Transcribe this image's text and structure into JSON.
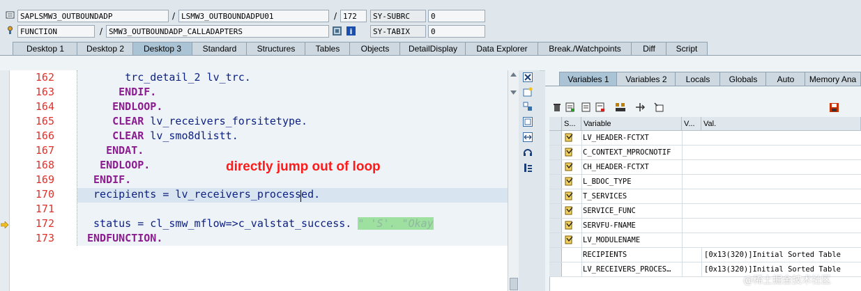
{
  "header": {
    "program": "SAPLSMW3_OUTBOUNDADP",
    "include": "LSMW3_OUTBOUNDADPU01",
    "line": "172",
    "subrc_label": "SY-SUBRC",
    "subrc_value": "0",
    "event_type": "FUNCTION",
    "event_name": "SMW3_OUTBOUNDADP_CALLADAPTERS",
    "tabix_label": "SY-TABIX",
    "tabix_value": "0",
    "slash": "/"
  },
  "tabs": [
    "Desktop 1",
    "Desktop 2",
    "Desktop 3",
    "Standard",
    "Structures",
    "Tables",
    "Objects",
    "DetailDisplay",
    "Data Explorer",
    "Break./Watchpoints",
    "Diff",
    "Script"
  ],
  "code": [
    {
      "num": "162",
      "indent": "      ",
      "kw": "",
      "text": "trc_detail_2 lv_trc."
    },
    {
      "num": "163",
      "indent": "     ",
      "kw": "ENDIF.",
      "text": ""
    },
    {
      "num": "164",
      "indent": "    ",
      "kw": "ENDLOOP.",
      "text": ""
    },
    {
      "num": "165",
      "indent": "    ",
      "kw": "CLEAR",
      "text": " lv_receivers_forsitetype."
    },
    {
      "num": "166",
      "indent": "    ",
      "kw": "CLEAR",
      "text": " lv_smo8dlistt."
    },
    {
      "num": "167",
      "indent": "   ",
      "kw": "ENDAT.",
      "text": ""
    },
    {
      "num": "168",
      "indent": "  ",
      "kw": "ENDLOOP.",
      "text": ""
    },
    {
      "num": "169",
      "indent": " ",
      "kw": "ENDIF.",
      "text": ""
    },
    {
      "num": "170",
      "indent": " ",
      "kw": "",
      "text": "recipients = lv_receivers_processed."
    },
    {
      "num": "171",
      "indent": "",
      "kw": "",
      "text": ""
    },
    {
      "num": "172",
      "indent": " ",
      "kw": "",
      "text": "status = cl_smw_mflow=>c_valstat_success. ",
      "comment": "\" 'S'. \"Okay"
    },
    {
      "num": "173",
      "indent": "",
      "kw": "ENDFUNCTION.",
      "text": ""
    }
  ],
  "annotation": "directly jump out of loop",
  "right_tabs": [
    "Variables 1",
    "Variables 2",
    "Locals",
    "Globals",
    "Auto",
    "Memory Ana"
  ],
  "grid": {
    "headers": [
      "S...",
      "Variable",
      "V...",
      "Val."
    ],
    "rows": [
      {
        "name": "LV_HEADER-FCTXT",
        "value": "",
        "icon": true
      },
      {
        "name": "C_CONTEXT_MPROCNOTIF",
        "value": "",
        "icon": true
      },
      {
        "name": "CH_HEADER-FCTXT",
        "value": "",
        "icon": true
      },
      {
        "name": "L_BDOC_TYPE",
        "value": "",
        "icon": true
      },
      {
        "name": "T_SERVICES",
        "value": "",
        "icon": true
      },
      {
        "name": "SERVICE_FUNC",
        "value": "",
        "icon": true
      },
      {
        "name": "SERVFU-FNAME",
        "value": "",
        "icon": true
      },
      {
        "name": "LV_MODULENAME",
        "value": "",
        "icon": true
      },
      {
        "name": "RECIPIENTS",
        "value": "[0x13(320)]Initial Sorted Table",
        "icon": false
      },
      {
        "name": "LV_RECEIVERS_PROCES…",
        "value": "[0x13(320)]Initial Sorted Table",
        "icon": false
      }
    ]
  },
  "watermark": "@稀土掘金技术社区",
  "colors": {
    "accent": "#aac4d6",
    "linenum": "#e0302b",
    "keyword": "#8b1c8f",
    "annotation": "#ff1a1a"
  }
}
